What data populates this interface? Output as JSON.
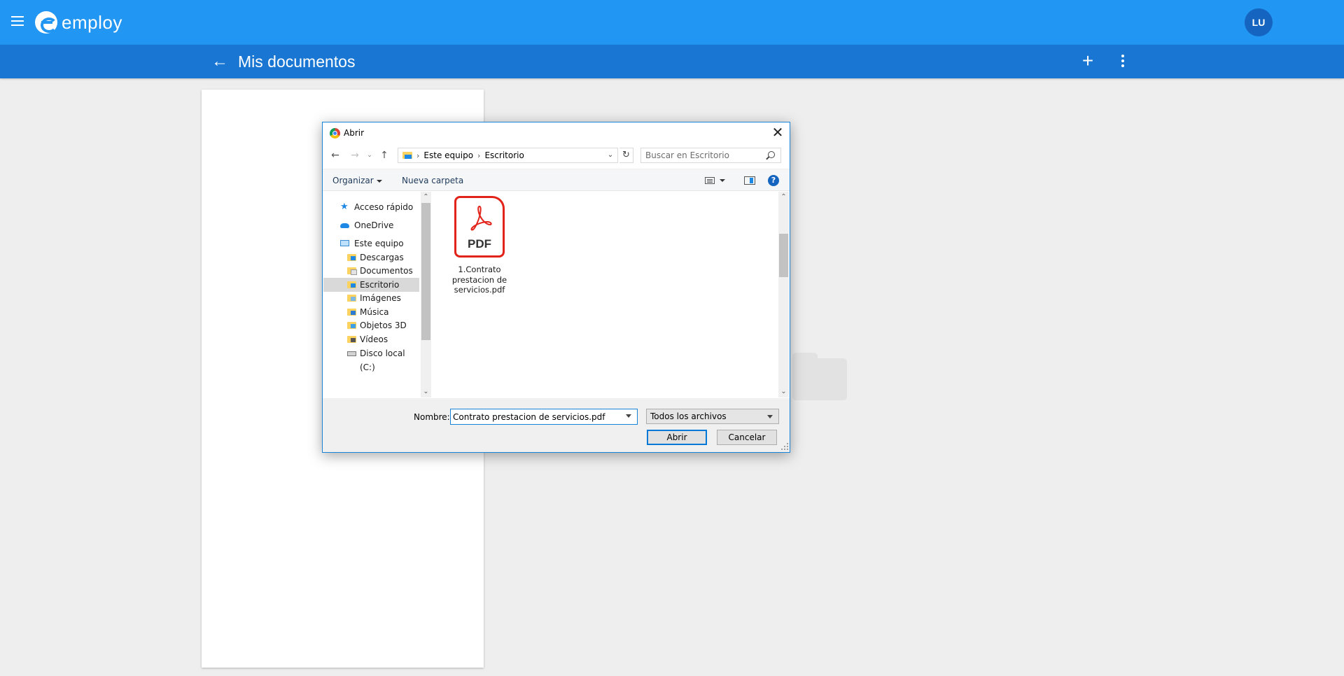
{
  "app": {
    "logo_text": "employ",
    "avatar_initials": "LU",
    "brand_color": "#2196f3"
  },
  "subbar": {
    "title": "Mis documentos"
  },
  "dialog": {
    "title": "Abrir",
    "address": {
      "crumbs": [
        "Este equipo",
        "Escritorio"
      ]
    },
    "search": {
      "placeholder": "Buscar en Escritorio"
    },
    "toolbar": {
      "organize_label": "Organizar",
      "new_folder_label": "Nueva carpeta",
      "help_label": "?"
    },
    "tree": [
      {
        "label": "Acceso rápido",
        "icon": "star-icon"
      },
      {
        "label": "OneDrive",
        "icon": "cloud-icon"
      },
      {
        "label": "Este equipo",
        "icon": "computer-icon"
      },
      {
        "label": "Descargas",
        "icon": "downloads-folder-icon"
      },
      {
        "label": "Documentos",
        "icon": "documents-folder-icon"
      },
      {
        "label": "Escritorio",
        "icon": "desktop-folder-icon",
        "selected": true
      },
      {
        "label": "Imágenes",
        "icon": "pictures-folder-icon"
      },
      {
        "label": "Música",
        "icon": "music-folder-icon"
      },
      {
        "label": "Objetos 3D",
        "icon": "3d-objects-folder-icon"
      },
      {
        "label": "Vídeos",
        "icon": "videos-folder-icon"
      },
      {
        "label": "Disco local (C:)",
        "icon": "disk-icon"
      }
    ],
    "files": [
      {
        "name_lines": [
          "1.Contrato",
          "prestacion de",
          "servicios.pdf"
        ],
        "icon_label": "PDF",
        "icon": "pdf-icon"
      }
    ],
    "name_label": "Nombre:",
    "name_value": "Contrato prestacion de servicios.pdf",
    "file_type": "Todos los archivos",
    "open_label": "Abrir",
    "cancel_label": "Cancelar"
  }
}
